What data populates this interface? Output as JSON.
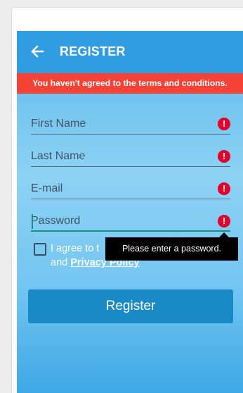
{
  "appbar": {
    "title": "REGISTER",
    "back_icon": "arrow-left-icon"
  },
  "error_banner": {
    "message": "You haven't agreed to the terms and conditions."
  },
  "form": {
    "fields": [
      {
        "label": "First Name",
        "error_icon": "error-exclamation-icon"
      },
      {
        "label": "Last Name",
        "error_icon": "error-exclamation-icon"
      },
      {
        "label": "E-mail",
        "error_icon": "error-exclamation-icon"
      },
      {
        "label": "Password",
        "error_icon": "error-exclamation-icon",
        "focused": true
      }
    ],
    "error_icon_glyph": "!",
    "tooltip": "Please enter a password.",
    "terms": {
      "prefix": "I agree to ",
      "hidden_part": "t",
      "line2_prefix": "and ",
      "privacy_link": "Privacy Policy",
      "checked": false
    },
    "submit_label": "Register"
  },
  "colors": {
    "appbar": "#2f9de0",
    "banner": "#f44336",
    "error_icon": "#e5002b",
    "button": "#198ac5",
    "focus": "#1c8f84"
  }
}
